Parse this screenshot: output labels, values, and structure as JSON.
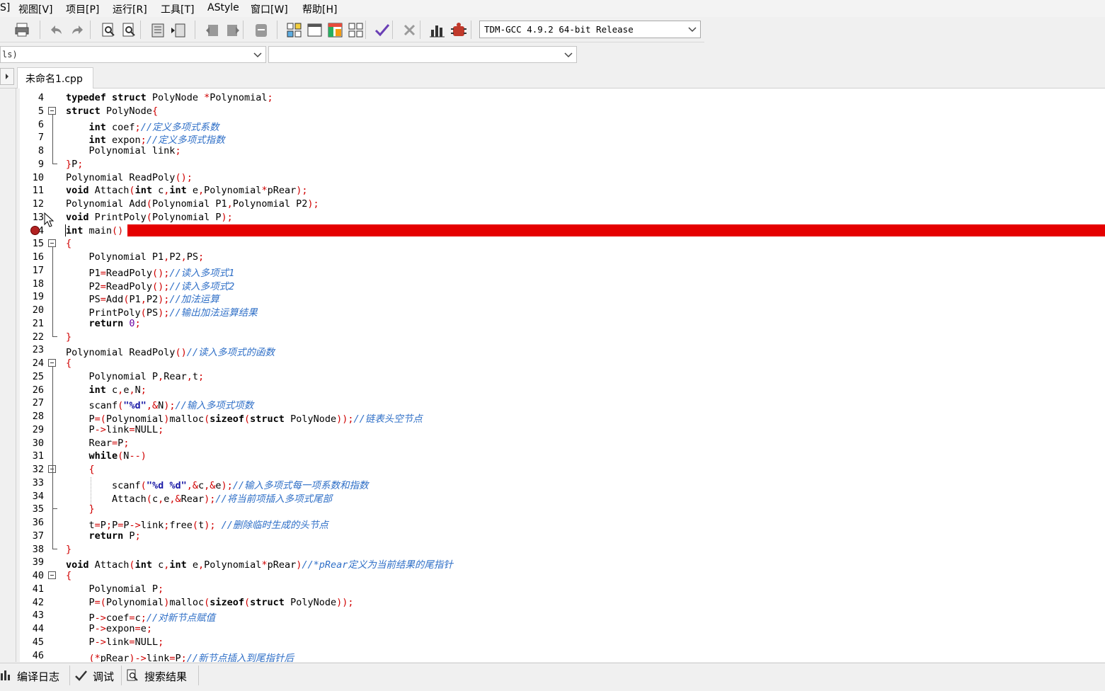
{
  "menu": [
    "S]",
    "视图[V]",
    "项目[P]",
    "运行[R]",
    "工具[T]",
    "AStyle",
    "窗口[W]",
    "帮助[H]"
  ],
  "toolbar": {
    "icons": [
      "print-icon",
      "undo-icon",
      "redo-icon",
      "find-icon",
      "replace-icon",
      "indent-icon",
      "unindent-icon",
      "bookmark-prev-icon",
      "bookmark-next-icon",
      "bookmark-icon",
      "grid-icon",
      "window-icon",
      "layout-icon",
      "tiles-icon",
      "check-icon",
      "delete-icon",
      "chart-icon",
      "debug-icon"
    ],
    "compiler": "TDM-GCC 4.9.2 64-bit Release"
  },
  "combo_left": "ls)",
  "combo_right": "",
  "file_tab": "未命名1.cpp",
  "breakpoint_line": 14,
  "lines": [
    {
      "n": "4",
      "segs": [
        [
          "kw",
          "typedef struct "
        ],
        [
          "t",
          "PolyNode "
        ],
        [
          "p",
          "*"
        ],
        [
          "t",
          "Polynomial"
        ],
        [
          "p",
          ";"
        ]
      ]
    },
    {
      "n": "5",
      "fold": "open",
      "segs": [
        [
          "kw",
          "struct "
        ],
        [
          "t",
          "PolyNode"
        ],
        [
          "p",
          "{"
        ]
      ]
    },
    {
      "n": "6",
      "segs": [
        [
          "t",
          "    "
        ],
        [
          "kw",
          "int "
        ],
        [
          "t",
          "coef"
        ],
        [
          "p",
          ";"
        ],
        [
          "c",
          "//定义多项式系数"
        ]
      ]
    },
    {
      "n": "7",
      "segs": [
        [
          "t",
          "    "
        ],
        [
          "kw",
          "int "
        ],
        [
          "t",
          "expon"
        ],
        [
          "p",
          ";"
        ],
        [
          "c",
          "//定义多项式指数"
        ]
      ]
    },
    {
      "n": "8",
      "segs": [
        [
          "t",
          "    Polynomial link"
        ],
        [
          "p",
          ";"
        ]
      ]
    },
    {
      "n": "9",
      "fold": "end",
      "segs": [
        [
          "p",
          "}"
        ],
        [
          "t",
          "P"
        ],
        [
          "p",
          ";"
        ]
      ]
    },
    {
      "n": "10",
      "segs": [
        [
          "t",
          "Polynomial ReadPoly"
        ],
        [
          "p",
          "();"
        ]
      ]
    },
    {
      "n": "11",
      "segs": [
        [
          "kw",
          "void "
        ],
        [
          "t",
          "Attach"
        ],
        [
          "p",
          "("
        ],
        [
          "kw",
          "int "
        ],
        [
          "t",
          "c"
        ],
        [
          "p",
          ","
        ],
        [
          "kw",
          "int "
        ],
        [
          "t",
          "e"
        ],
        [
          "p",
          ","
        ],
        [
          "t",
          "Polynomial"
        ],
        [
          "p",
          "*"
        ],
        [
          "t",
          "pRear"
        ],
        [
          "p",
          ");"
        ]
      ]
    },
    {
      "n": "12",
      "segs": [
        [
          "t",
          "Polynomial Add"
        ],
        [
          "p",
          "("
        ],
        [
          "t",
          "Polynomial P1"
        ],
        [
          "p",
          ","
        ],
        [
          "t",
          "Polynomial P2"
        ],
        [
          "p",
          ");"
        ]
      ]
    },
    {
      "n": "13",
      "segs": [
        [
          "kw",
          "void "
        ],
        [
          "t",
          "PrintPoly"
        ],
        [
          "p",
          "("
        ],
        [
          "t",
          "Polynomial P"
        ],
        [
          "p",
          ");"
        ]
      ]
    },
    {
      "n": "14",
      "segs": [
        [
          "kw",
          "int "
        ],
        [
          "t",
          "main"
        ],
        [
          "p",
          "()"
        ]
      ]
    },
    {
      "n": "15",
      "fold": "open",
      "segs": [
        [
          "p",
          "{"
        ]
      ]
    },
    {
      "n": "16",
      "segs": [
        [
          "t",
          "    Polynomial P1"
        ],
        [
          "p",
          ","
        ],
        [
          "t",
          "P2"
        ],
        [
          "p",
          ","
        ],
        [
          "t",
          "PS"
        ],
        [
          "p",
          ";"
        ]
      ]
    },
    {
      "n": "17",
      "segs": [
        [
          "t",
          "    P1"
        ],
        [
          "p",
          "="
        ],
        [
          "t",
          "ReadPoly"
        ],
        [
          "p",
          "();"
        ],
        [
          "c",
          "//读入多项式1"
        ]
      ]
    },
    {
      "n": "18",
      "segs": [
        [
          "t",
          "    P2"
        ],
        [
          "p",
          "="
        ],
        [
          "t",
          "ReadPoly"
        ],
        [
          "p",
          "();"
        ],
        [
          "c",
          "//读入多项式2"
        ]
      ]
    },
    {
      "n": "19",
      "segs": [
        [
          "t",
          "    PS"
        ],
        [
          "p",
          "="
        ],
        [
          "t",
          "Add"
        ],
        [
          "p",
          "("
        ],
        [
          "t",
          "P1"
        ],
        [
          "p",
          ","
        ],
        [
          "t",
          "P2"
        ],
        [
          "p",
          ");"
        ],
        [
          "c",
          "//加法运算"
        ]
      ]
    },
    {
      "n": "20",
      "segs": [
        [
          "t",
          "    PrintPoly"
        ],
        [
          "p",
          "("
        ],
        [
          "t",
          "PS"
        ],
        [
          "p",
          ");"
        ],
        [
          "c",
          "//输出加法运算结果"
        ]
      ]
    },
    {
      "n": "21",
      "segs": [
        [
          "t",
          "    "
        ],
        [
          "kw",
          "return "
        ],
        [
          "n",
          "0"
        ],
        [
          "p",
          ";"
        ]
      ]
    },
    {
      "n": "22",
      "fold": "end",
      "segs": [
        [
          "p",
          "}"
        ]
      ]
    },
    {
      "n": "23",
      "segs": [
        [
          "t",
          "Polynomial ReadPoly"
        ],
        [
          "p",
          "()"
        ],
        [
          "c",
          "//读入多项式的函数"
        ]
      ]
    },
    {
      "n": "24",
      "fold": "open",
      "segs": [
        [
          "p",
          "{"
        ]
      ]
    },
    {
      "n": "25",
      "segs": [
        [
          "t",
          "    Polynomial P"
        ],
        [
          "p",
          ","
        ],
        [
          "t",
          "Rear"
        ],
        [
          "p",
          ","
        ],
        [
          "t",
          "t"
        ],
        [
          "p",
          ";"
        ]
      ]
    },
    {
      "n": "26",
      "segs": [
        [
          "t",
          "    "
        ],
        [
          "kw",
          "int "
        ],
        [
          "t",
          "c"
        ],
        [
          "p",
          ","
        ],
        [
          "t",
          "e"
        ],
        [
          "p",
          ","
        ],
        [
          "t",
          "N"
        ],
        [
          "p",
          ";"
        ]
      ]
    },
    {
      "n": "27",
      "segs": [
        [
          "t",
          "    scanf"
        ],
        [
          "p",
          "("
        ],
        [
          "s",
          "\"%d\""
        ],
        [
          "p",
          ",&"
        ],
        [
          "t",
          "N"
        ],
        [
          "p",
          ");"
        ],
        [
          "c",
          "//输入多项式项数"
        ]
      ]
    },
    {
      "n": "28",
      "segs": [
        [
          "t",
          "    P"
        ],
        [
          "p",
          "=("
        ],
        [
          "t",
          "Polynomial"
        ],
        [
          "p",
          ")"
        ],
        [
          "t",
          "malloc"
        ],
        [
          "p",
          "("
        ],
        [
          "kw",
          "sizeof"
        ],
        [
          "p",
          "("
        ],
        [
          "kw",
          "struct "
        ],
        [
          "t",
          "PolyNode"
        ],
        [
          "p",
          "));"
        ],
        [
          "c",
          "//链表头空节点"
        ]
      ]
    },
    {
      "n": "29",
      "segs": [
        [
          "t",
          "    P"
        ],
        [
          "p",
          "->"
        ],
        [
          "t",
          "link"
        ],
        [
          "p",
          "="
        ],
        [
          "t",
          "NULL"
        ],
        [
          "p",
          ";"
        ]
      ]
    },
    {
      "n": "30",
      "segs": [
        [
          "t",
          "    Rear"
        ],
        [
          "p",
          "="
        ],
        [
          "t",
          "P"
        ],
        [
          "p",
          ";"
        ]
      ]
    },
    {
      "n": "31",
      "segs": [
        [
          "t",
          "    "
        ],
        [
          "kw",
          "while"
        ],
        [
          "p",
          "("
        ],
        [
          "t",
          "N"
        ],
        [
          "p",
          "--)"
        ]
      ]
    },
    {
      "n": "32",
      "fold": "open2",
      "segs": [
        [
          "t",
          "    "
        ],
        [
          "p",
          "{"
        ]
      ]
    },
    {
      "n": "33",
      "segs": [
        [
          "t",
          "        scanf"
        ],
        [
          "p",
          "("
        ],
        [
          "s",
          "\"%d %d\""
        ],
        [
          "p",
          ",&"
        ],
        [
          "t",
          "c"
        ],
        [
          "p",
          ",&"
        ],
        [
          "t",
          "e"
        ],
        [
          "p",
          ");"
        ],
        [
          "c",
          "//输入多项式每一项系数和指数"
        ]
      ]
    },
    {
      "n": "34",
      "segs": [
        [
          "t",
          "        Attach"
        ],
        [
          "p",
          "("
        ],
        [
          "t",
          "c"
        ],
        [
          "p",
          ","
        ],
        [
          "t",
          "e"
        ],
        [
          "p",
          ",&"
        ],
        [
          "t",
          "Rear"
        ],
        [
          "p",
          ");"
        ],
        [
          "c",
          "//将当前项插入多项式尾部"
        ]
      ]
    },
    {
      "n": "35",
      "fold": "end2",
      "segs": [
        [
          "t",
          "    "
        ],
        [
          "p",
          "}"
        ]
      ]
    },
    {
      "n": "36",
      "segs": [
        [
          "t",
          "    t"
        ],
        [
          "p",
          "="
        ],
        [
          "t",
          "P"
        ],
        [
          "p",
          ";"
        ],
        [
          "t",
          "P"
        ],
        [
          "p",
          "="
        ],
        [
          "t",
          "P"
        ],
        [
          "p",
          "->"
        ],
        [
          "t",
          "link"
        ],
        [
          "p",
          ";"
        ],
        [
          "t",
          "free"
        ],
        [
          "p",
          "("
        ],
        [
          "t",
          "t"
        ],
        [
          "p",
          ");"
        ],
        [
          "t",
          " "
        ],
        [
          "c",
          "//删除临时生成的头节点"
        ]
      ]
    },
    {
      "n": "37",
      "segs": [
        [
          "t",
          "    "
        ],
        [
          "kw",
          "return "
        ],
        [
          "t",
          "P"
        ],
        [
          "p",
          ";"
        ]
      ]
    },
    {
      "n": "38",
      "fold": "end",
      "segs": [
        [
          "p",
          "}"
        ]
      ]
    },
    {
      "n": "39",
      "segs": [
        [
          "kw",
          "void "
        ],
        [
          "t",
          "Attach"
        ],
        [
          "p",
          "("
        ],
        [
          "kw",
          "int "
        ],
        [
          "t",
          "c"
        ],
        [
          "p",
          ","
        ],
        [
          "kw",
          "int "
        ],
        [
          "t",
          "e"
        ],
        [
          "p",
          ","
        ],
        [
          "t",
          "Polynomial"
        ],
        [
          "p",
          "*"
        ],
        [
          "t",
          "pRear"
        ],
        [
          "p",
          ")"
        ],
        [
          "c",
          "//*pRear定义为当前结果的尾指针"
        ]
      ]
    },
    {
      "n": "40",
      "fold": "open",
      "segs": [
        [
          "p",
          "{"
        ]
      ]
    },
    {
      "n": "41",
      "segs": [
        [
          "t",
          "    Polynomial P"
        ],
        [
          "p",
          ";"
        ]
      ]
    },
    {
      "n": "42",
      "segs": [
        [
          "t",
          "    P"
        ],
        [
          "p",
          "=("
        ],
        [
          "t",
          "Polynomial"
        ],
        [
          "p",
          ")"
        ],
        [
          "t",
          "malloc"
        ],
        [
          "p",
          "("
        ],
        [
          "kw",
          "sizeof"
        ],
        [
          "p",
          "("
        ],
        [
          "kw",
          "struct "
        ],
        [
          "t",
          "PolyNode"
        ],
        [
          "p",
          "));"
        ]
      ]
    },
    {
      "n": "43",
      "segs": [
        [
          "t",
          "    P"
        ],
        [
          "p",
          "->"
        ],
        [
          "t",
          "coef"
        ],
        [
          "p",
          "="
        ],
        [
          "t",
          "c"
        ],
        [
          "p",
          ";"
        ],
        [
          "c",
          "//对新节点赋值"
        ]
      ]
    },
    {
      "n": "44",
      "segs": [
        [
          "t",
          "    P"
        ],
        [
          "p",
          "->"
        ],
        [
          "t",
          "expon"
        ],
        [
          "p",
          "="
        ],
        [
          "t",
          "e"
        ],
        [
          "p",
          ";"
        ]
      ]
    },
    {
      "n": "45",
      "segs": [
        [
          "t",
          "    P"
        ],
        [
          "p",
          "->"
        ],
        [
          "t",
          "link"
        ],
        [
          "p",
          "="
        ],
        [
          "t",
          "NULL"
        ],
        [
          "p",
          ";"
        ]
      ]
    },
    {
      "n": "46",
      "segs": [
        [
          "t",
          "    "
        ],
        [
          "p",
          "(*"
        ],
        [
          "t",
          "pRear"
        ],
        [
          "p",
          ")->"
        ],
        [
          "t",
          "link"
        ],
        [
          "p",
          "="
        ],
        [
          "t",
          "P"
        ],
        [
          "p",
          ";"
        ],
        [
          "c",
          "//新节点插入到尾指针后"
        ]
      ]
    }
  ],
  "bottom_tabs": [
    {
      "icon": "chart-icon",
      "label": "编译日志"
    },
    {
      "icon": "check-icon",
      "label": "调试"
    },
    {
      "icon": "search-icon",
      "label": "搜索结果"
    }
  ]
}
